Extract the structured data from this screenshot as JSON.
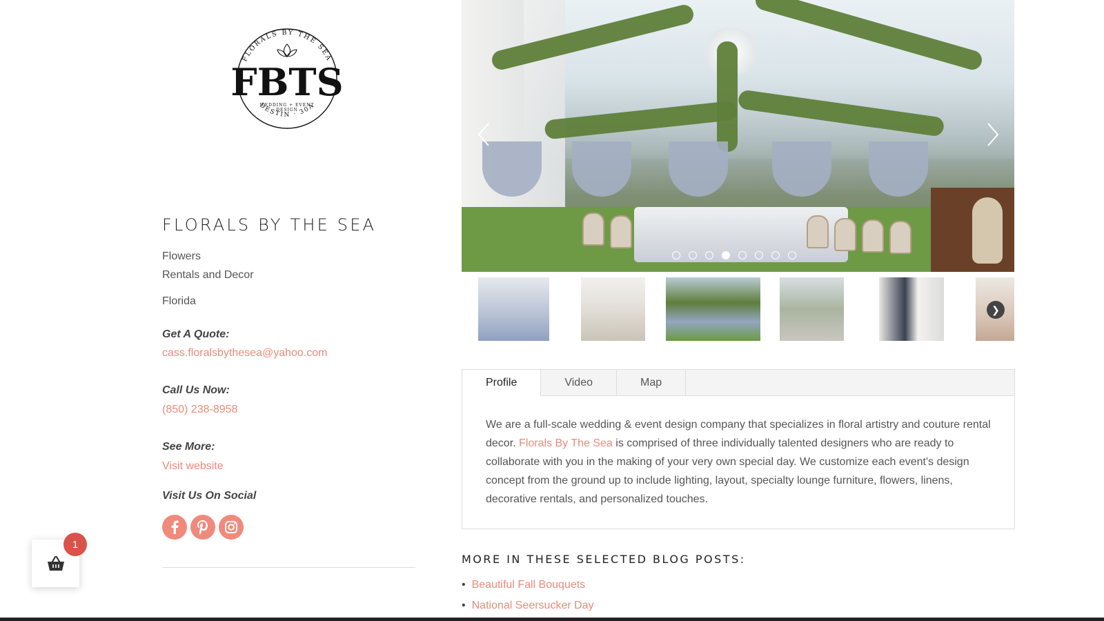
{
  "logo": {
    "monogram": "FBTS",
    "ring_top": "FLORALS BY THE SEA",
    "ring_bottom": "DESTIN · 30A",
    "tagline_1": "WEDDING + EVENT",
    "tagline_2": "DESIGN"
  },
  "vendor": {
    "name": "FLORALS BY THE SEA",
    "categories": [
      "Flowers",
      "Rentals and Decor"
    ],
    "location": "Florida"
  },
  "contact": {
    "quote_label": "Get A Quote:",
    "email": "cass.floralsbythesea@yahoo.com",
    "call_label": "Call Us Now:",
    "phone": "(850) 238-8958",
    "see_more_label": "See More:",
    "website_text": "Visit website",
    "social_label": "Visit Us On Social"
  },
  "social": {
    "icons": [
      "facebook-icon",
      "pinterest-icon",
      "instagram-icon"
    ],
    "color": "#f08a7c"
  },
  "cart": {
    "count": "1",
    "icon": "basket-icon"
  },
  "gallery": {
    "slide_count": 8,
    "active_slide": 3,
    "thumbnail_count": 6
  },
  "tabs": {
    "items": [
      "Profile",
      "Video",
      "Map"
    ],
    "active": "Profile",
    "profile_text_1": "We are a full-scale wedding & event design company that specializes in floral artistry and couture rental decor.",
    "profile_link": "Florals By The Sea",
    "profile_text_2": "is comprised of three individually talented designers who are ready to collaborate with you in the making of your very own special day. We customize each event's design concept from the ground up to include lighting, layout, specialty lounge furniture, flowers, linens, decorative rentals, and personalized touches."
  },
  "blog": {
    "heading": "MORE IN THESE SELECTED BLOG POSTS:",
    "posts": [
      "Beautiful Fall Bouquets",
      "National Seersucker Day"
    ]
  },
  "colors": {
    "accent": "#ea8a7a",
    "badge": "#d9534a",
    "text": "#444444"
  }
}
